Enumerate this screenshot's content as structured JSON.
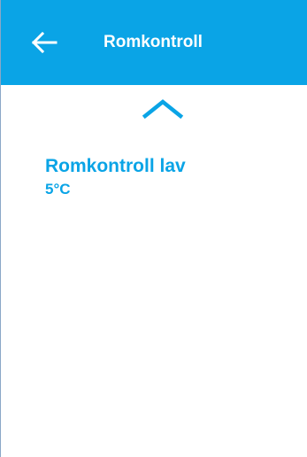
{
  "header": {
    "title": "Romkontroll",
    "back_icon": "arrow-left-icon"
  },
  "main": {
    "scroll_up_icon": "chevron-up-icon",
    "setting": {
      "name": "Romkontroll lav",
      "value": "5°C"
    }
  },
  "colors": {
    "accent": "#0aa4e6",
    "header_text": "#ffffff",
    "background": "#ffffff"
  }
}
